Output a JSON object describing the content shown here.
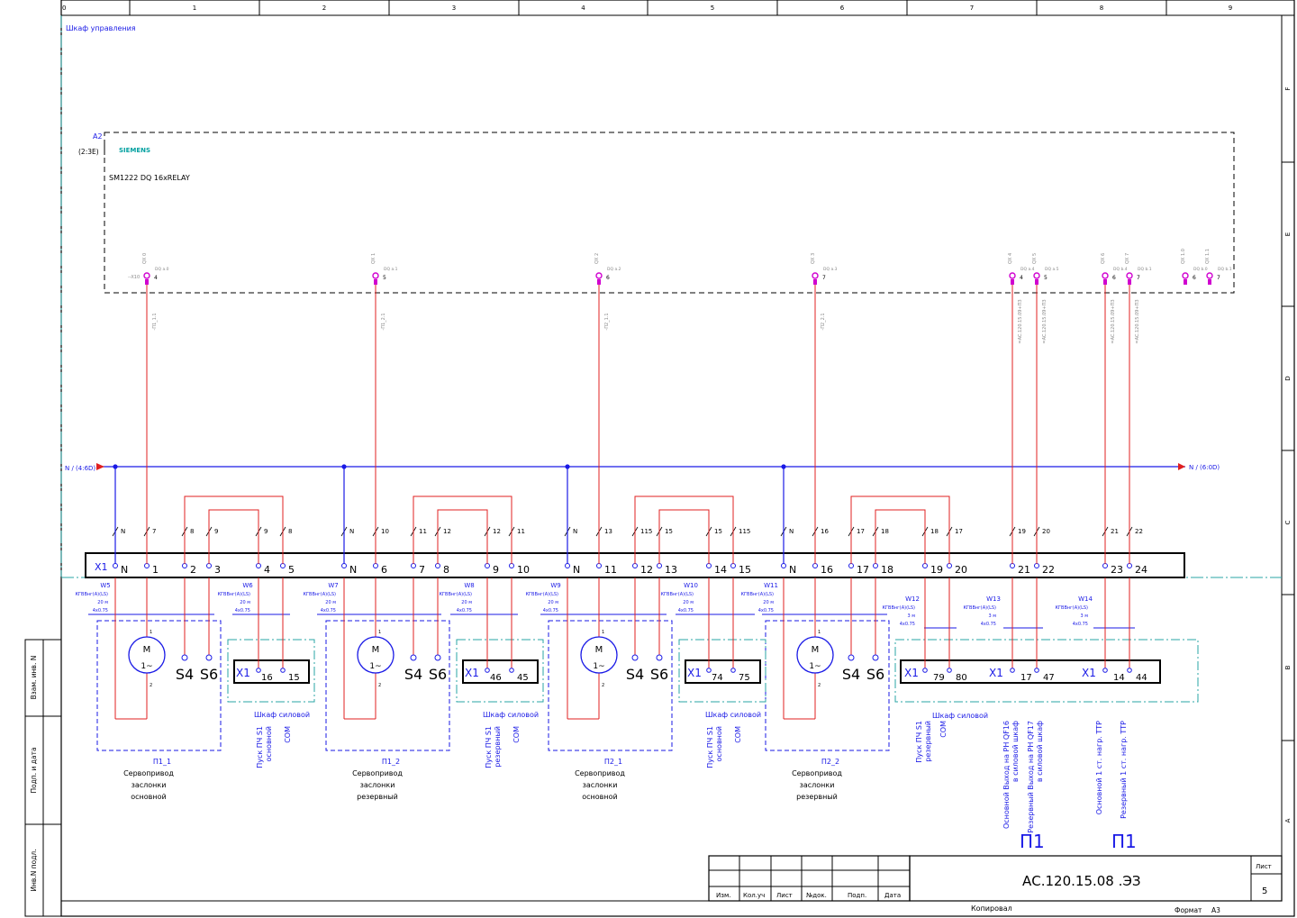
{
  "colors": {
    "frame": "#000000",
    "neutral": "#1a1ae6",
    "signal": "#e02020",
    "relay_pin": "#d000d0",
    "cabinet_border": "#2aa6a6",
    "siemens": "#00a0a0"
  },
  "grid_columns": [
    "0",
    "1",
    "2",
    "3",
    "4",
    "5",
    "6",
    "7",
    "8",
    "9"
  ],
  "grid_rows": [
    "F",
    "E",
    "D",
    "C",
    "B",
    "A"
  ],
  "side_labels": [
    "Взам. инв. N",
    "Подп. и дата",
    "Инв.N подл."
  ],
  "cabinet_title": "Шкаф управления",
  "plc": {
    "tag": "A2",
    "ref": "(2:3E)",
    "brand": "SIEMENS",
    "model": "SM1222 DQ 16xRELAY",
    "terminal_ref": "--X10"
  },
  "outputs": [
    {
      "addr": "QX 0",
      "ch": "DQ a.0",
      "pin": "4",
      "wire": "-П1_1.1"
    },
    {
      "addr": "QX 1",
      "ch": "DQ a.1",
      "pin": "5",
      "wire": "-П1_2.1"
    },
    {
      "addr": "QX 2",
      "ch": "DQ a.2",
      "pin": "6",
      "wire": "-П2_1.1"
    },
    {
      "addr": "QX 3",
      "ch": "DQ a.3",
      "pin": "7",
      "wire": "-П2_2.1"
    },
    {
      "addr": "QX 4",
      "ch": "DQ a.4",
      "pin": "4",
      "wire": "=AC.120.15.09+ПЗ"
    },
    {
      "addr": "QX 5",
      "ch": "DQ a.5",
      "pin": "5",
      "wire": "=AC.120.15.09+ПЗ"
    },
    {
      "addr": "QX 6",
      "ch": "DQ b.4",
      "pin": "6",
      "wire": "=AC.120.15.09+ПЗ"
    },
    {
      "addr": "QX 7",
      "ch": "DQ b.1",
      "pin": "7",
      "wire": "=AC.120.15.09+ПЗ"
    },
    {
      "addr": "QX 1.0",
      "ch": "DQ b.0",
      "pin": "6",
      "wire": ""
    },
    {
      "addr": "QX 1.1",
      "ch": "DQ b.1",
      "pin": "7",
      "wire": ""
    }
  ],
  "bus": {
    "left": "N / (4:6D)",
    "right": "N / (6:0D)"
  },
  "strip": {
    "tag": "X1",
    "terminals": [
      "N",
      "1",
      "2",
      "3",
      "4",
      "5",
      "N",
      "6",
      "7",
      "8",
      "9",
      "10",
      "N",
      "11",
      "12",
      "13",
      "14",
      "15",
      "N",
      "16",
      "17",
      "18",
      "19",
      "20",
      "21",
      "22",
      "23",
      "24"
    ]
  },
  "wire_numbers": [
    "N",
    "7",
    "8",
    "9",
    "9",
    "8",
    "N",
    "10",
    "11",
    "12",
    "12",
    "11",
    "N",
    "13",
    "115",
    "15",
    "15",
    "115",
    "N",
    "16",
    "17",
    "18",
    "18",
    "17",
    "19",
    "20",
    "21",
    "22"
  ],
  "cables": [
    {
      "tag": "W5",
      "type": "КГВВнг(А)(LS)",
      "len": "20 м",
      "size": "4x0.75"
    },
    {
      "tag": "W6",
      "type": "КГВВнг(А)(LS)",
      "len": "20 м",
      "size": "4x0.75"
    },
    {
      "tag": "W7",
      "type": "КГВВнг(А)(LS)",
      "len": "20 м",
      "size": "4x0.75"
    },
    {
      "tag": "W8",
      "type": "КГВВнг(А)(LS)",
      "len": "20 м",
      "size": "4x0.75"
    },
    {
      "tag": "W9",
      "type": "КГВВнг(А)(LS)",
      "len": "20 м",
      "size": "4x0.75"
    },
    {
      "tag": "W10",
      "type": "КГВВнг(А)(LS)",
      "len": "20 м",
      "size": "4x0.75"
    },
    {
      "tag": "W11",
      "type": "КГВВнг(А)(LS)",
      "len": "20 м",
      "size": "4x0.75"
    },
    {
      "tag": "W12",
      "type": "КГВВнг(А)(LS)",
      "len": "3 м",
      "size": "4x0.75"
    },
    {
      "tag": "W13",
      "type": "КГВВнг(А)(LS)",
      "len": "3 м",
      "size": "4x0.75"
    },
    {
      "tag": "W14",
      "type": "КГВВнг(А)(LS)",
      "len": "3 м",
      "size": "4x0.75"
    }
  ],
  "motor": {
    "letter": "M",
    "phase": "1~",
    "s4": "S4",
    "s6": "S6"
  },
  "actuators": [
    {
      "tag": "П1_1",
      "l1": "Сервопривод",
      "l2": "заслонки",
      "l3": "основной"
    },
    {
      "tag": "П1_2",
      "l1": "Сервопривод",
      "l2": "заслонки",
      "l3": "резервный"
    },
    {
      "tag": "П2_1",
      "l1": "Сервопривод",
      "l2": "заслонки",
      "l3": "основной"
    },
    {
      "tag": "П2_2",
      "l1": "Сервопривод",
      "l2": "заслонки",
      "l3": "резервный"
    }
  ],
  "power_cab": "Шкаф силовой",
  "pwr_groups": [
    {
      "t1": "16",
      "t2": "15",
      "c1a": "Пуск ПЧ S1",
      "c1b": "основной",
      "c2": "COM"
    },
    {
      "t1": "46",
      "t2": "45",
      "c1a": "Пуск ПЧ S1",
      "c1b": "резервный",
      "c2": "COM"
    },
    {
      "t1": "74",
      "t2": "75",
      "c1a": "Пуск ПЧ S1",
      "c1b": "основной",
      "c2": "COM"
    }
  ],
  "big_box": {
    "pairs": [
      [
        "X1",
        "79",
        "80"
      ],
      [
        "X1",
        "17",
        "47"
      ],
      [
        "X1",
        "14",
        "44"
      ]
    ],
    "captions": [
      [
        "Пуск ПЧ S1",
        "резервный"
      ],
      [
        "COM"
      ],
      [
        "Основной Выход на РН QF16",
        "в силовой шкаф"
      ],
      [
        "Резервный Выход на РН QF17",
        "в силовой шкаф"
      ],
      [
        "Основной 1 ст. нагр. ТТР"
      ],
      [
        "Резервный 1 ст. нагр. ТТР"
      ]
    ],
    "big": [
      "П1",
      "П1"
    ]
  },
  "title_block": {
    "heads": [
      "Изм.",
      "Кол.уч",
      "Лист",
      "№док.",
      "Подп.",
      "Дата"
    ],
    "doc": "АС.120.15.08 .ЭЗ",
    "sheet_label": "Лист",
    "sheet": "5",
    "copied": "Копировал",
    "format_label": "Формат",
    "format": "А3"
  }
}
